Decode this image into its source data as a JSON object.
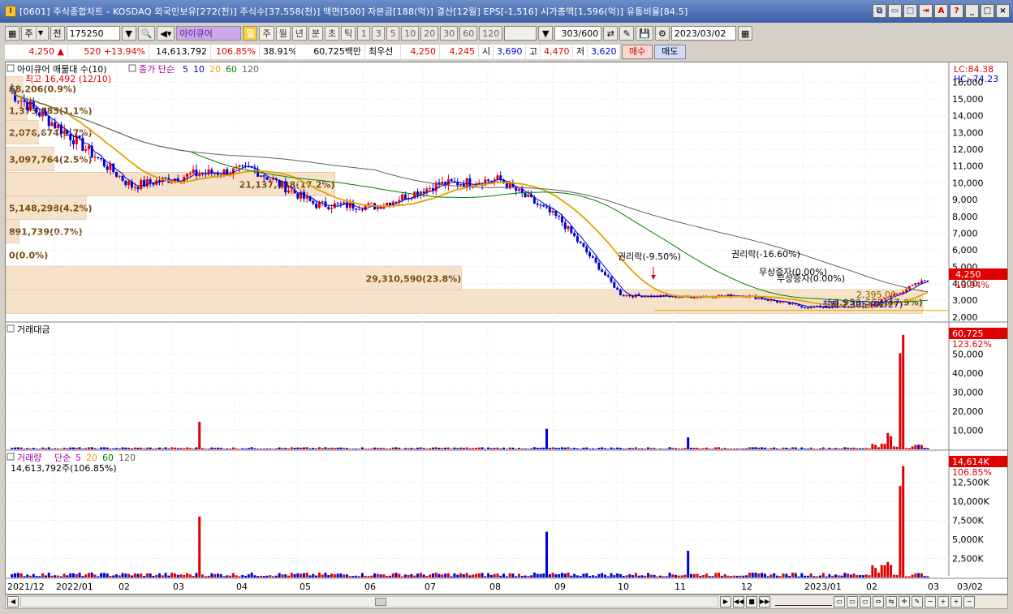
{
  "window": {
    "app_icon": "I",
    "title": "[0601] 주식종합차트 - KOSDAQ 외국인보유[272(천)] 주식수[37,558(천)] 액면[500] 자본금[188(억)] 결산[12월] EPS[-1,516] 시가총액[1,596(억)] 유통비율[84.5]",
    "buttons": [
      "⧉",
      "▭",
      "□",
      "⇥",
      "A",
      "?",
      "_",
      "□",
      "×"
    ]
  },
  "toolbar": {
    "chart_menu_label": "주",
    "prev_label": "전",
    "stock_code": "175250",
    "stock_name": "아이큐어",
    "periods": [
      "일",
      "주",
      "월",
      "년",
      "분",
      "초",
      "틱"
    ],
    "active_period": "일",
    "intervals": [
      "1",
      "3",
      "5",
      "10",
      "20",
      "30",
      "60",
      "120"
    ],
    "count": "303",
    "count_max": "/600",
    "date": "2023/03/02"
  },
  "quote": {
    "price": "4,250",
    "price_arrow": "▲",
    "change": "520",
    "change_pct": "+13.94%",
    "volume": "14,613,792",
    "volume_ratio": "106.85%",
    "turnover": "38.91%",
    "trade_amount": "60,725백만",
    "best_bid_label": "최우선",
    "ask": "4,250",
    "bid": "4,245",
    "open_label": "시",
    "open": "3,690",
    "high_label": "고",
    "high": "4,470",
    "low_label": "저",
    "low": "3,620",
    "buy_label": "매수",
    "sell_label": "매도"
  },
  "price_panel": {
    "legend_main": "아이큐어 매물대 수(10)",
    "legend_ma_label": "종가 단순",
    "legend_ma": [
      {
        "period": "5",
        "color": "#0000cc"
      },
      {
        "period": "10",
        "color": "#0000cc"
      },
      {
        "period": "20",
        "color": "#e8a000"
      },
      {
        "period": "60",
        "color": "#008000"
      },
      {
        "period": "120",
        "color": "#606060"
      }
    ],
    "lc": "LC:84.38",
    "hc": "HC:-74.23",
    "last_price": "4,250",
    "last_pct": "13.94%",
    "high_note": "최고 16,492 (12/10)",
    "low_note": "최저 2,305 (02/27)",
    "rights1": "권리락(-9.50%)",
    "rights2": "권리락(-16.60%)",
    "rights3": "무상증자(0.00%)",
    "rights4": "무상증자(0.00%)",
    "level_line_label": "2,395.00",
    "volume_profile": [
      {
        "label": "68,206(0.9%)",
        "price": 15600,
        "pct": 0.9
      },
      {
        "label": "1,373,485(1.1%)",
        "price": 14300,
        "pct": 1.1
      },
      {
        "label": "2,076,674(1.7%)",
        "price": 13000,
        "pct": 1.7
      },
      {
        "label": "3,097,764(2.5%)",
        "price": 11400,
        "pct": 2.5
      },
      {
        "label": "21,137,138(17.2%)",
        "price": 9900,
        "pct": 17.2
      },
      {
        "label": "5,148,298(4.2%)",
        "price": 8500,
        "pct": 4.2
      },
      {
        "label": "891,739(0.7%)",
        "price": 7100,
        "pct": 0.7
      },
      {
        "label": "0(0.0%)",
        "price": 5700,
        "pct": 0.0
      },
      {
        "label": "29,310,590(23.8%)",
        "price": 4300,
        "pct": 23.8
      },
      {
        "label": "58,959,552(47.9%)",
        "price": 2900,
        "pct": 47.9
      }
    ],
    "y_ticks": [
      "16,000",
      "15,000",
      "14,000",
      "13,000",
      "12,000",
      "11,000",
      "10,000",
      "9,000",
      "8,000",
      "7,000",
      "6,000",
      "5,000",
      "4,000",
      "3,000",
      "2,000"
    ]
  },
  "amount_panel": {
    "legend": "거래대금",
    "last_value": "60,725",
    "last_pct": "123.62%",
    "y_ticks": [
      "50,000",
      "40,000",
      "30,000",
      "20,000",
      "10,000"
    ]
  },
  "volume_panel": {
    "legend": "거래량",
    "legend_ma_label": "단순",
    "legend_ma": [
      {
        "period": "5",
        "color": "#cc00cc"
      },
      {
        "period": "20",
        "color": "#e8a000"
      },
      {
        "period": "60",
        "color": "#008000"
      },
      {
        "period": "120",
        "color": "#606060"
      }
    ],
    "current": "14,613,792주(106.85%)",
    "last_value": "14,614K",
    "last_pct": "106.85%",
    "y_ticks": [
      "12,500K",
      "10,000K",
      "7,500K",
      "5,000K",
      "2,500K"
    ]
  },
  "x_axis": [
    "2021/12",
    "2022/01",
    "02",
    "03",
    "04",
    "05",
    "06",
    "07",
    "08",
    "09",
    "10",
    "11",
    "12",
    "2023/01",
    "02",
    "03",
    "03/02"
  ],
  "colors": {
    "up": "#e00000",
    "down": "#0000d8",
    "profile": "#f5e2c8"
  },
  "chart_data": {
    "type": "candlestick",
    "title": "아이큐어",
    "x": [
      "2021/12",
      "2022/01",
      "02",
      "03",
      "04",
      "05",
      "06",
      "07",
      "08",
      "09",
      "10",
      "11",
      "12",
      "2023/01",
      "02",
      "03"
    ],
    "close_monthly_approx": [
      15500,
      12800,
      9800,
      10500,
      10800,
      8700,
      8600,
      9900,
      10200,
      7800,
      3300,
      3200,
      3300,
      2600,
      2600,
      4250
    ],
    "ylim": [
      1800,
      16500
    ],
    "amount_last": 60725,
    "volume_last": 14613792
  }
}
